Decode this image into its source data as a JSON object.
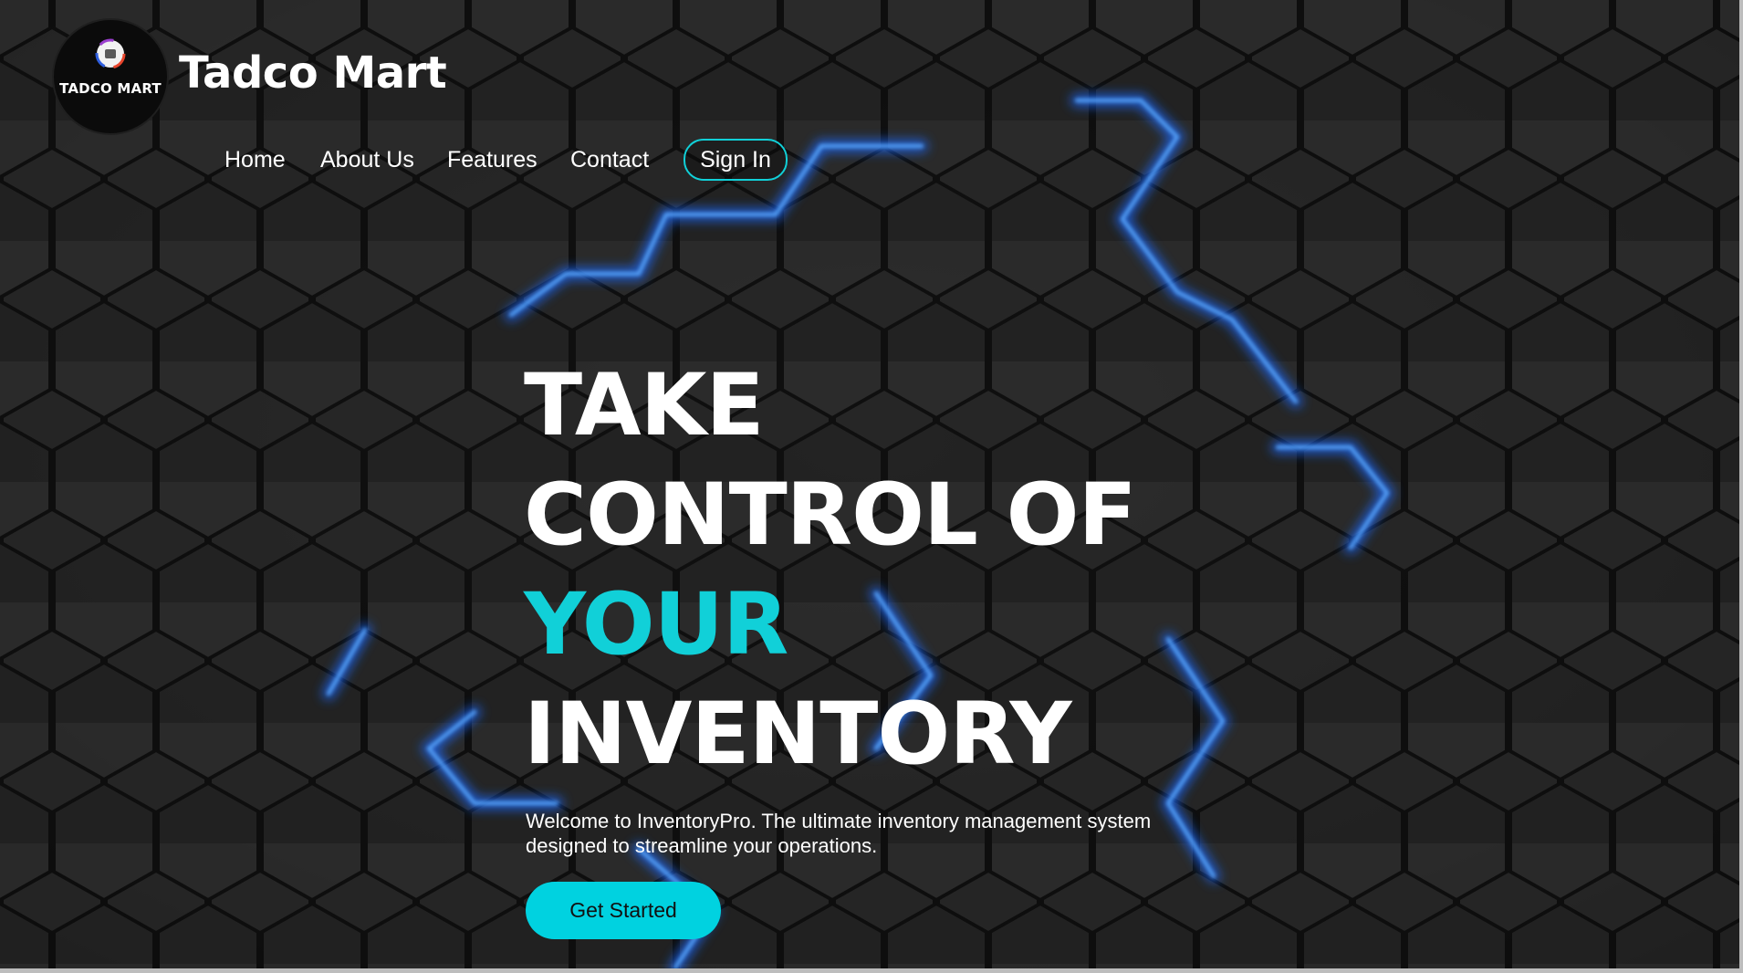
{
  "brand": {
    "badge_text": "TADCO MART",
    "title": "Tadco Mart"
  },
  "nav": {
    "items": [
      {
        "label": "Home"
      },
      {
        "label": "About Us"
      },
      {
        "label": "Features"
      },
      {
        "label": "Contact"
      }
    ],
    "signin_label": "Sign In"
  },
  "hero": {
    "line1": "TAKE",
    "line2": "CONTROL OF",
    "line3": "YOUR",
    "line4": "INVENTORY",
    "subtitle": "Welcome to InventoryPro. The ultimate inventory management system designed to streamline your operations.",
    "cta_label": "Get Started"
  },
  "colors": {
    "accent": "#11d0d8",
    "cta_bg": "#00d2e0",
    "glow": "#1e6bff",
    "background": "#151515"
  },
  "icons": {
    "logo": "tadco-logo-emblem"
  }
}
